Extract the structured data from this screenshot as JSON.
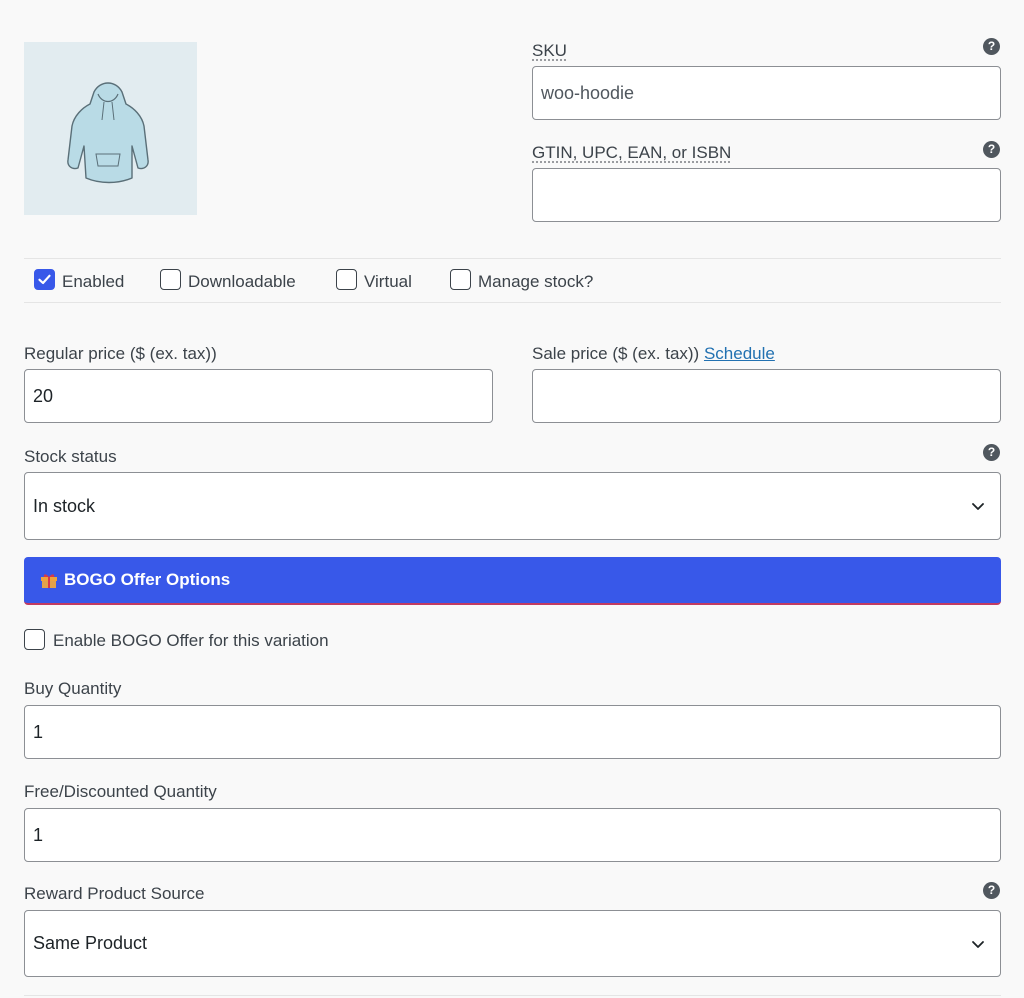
{
  "sku": {
    "label": "SKU",
    "value": "woo-hoodie"
  },
  "gtin": {
    "label": "GTIN, UPC, EAN, or ISBN",
    "value": ""
  },
  "options": [
    {
      "label": "Enabled",
      "checked": true
    },
    {
      "label": "Downloadable",
      "checked": false
    },
    {
      "label": "Virtual",
      "checked": false
    },
    {
      "label": "Manage stock?",
      "checked": false
    }
  ],
  "regular_price": {
    "label": "Regular price ($ (ex. tax))",
    "value": "20"
  },
  "sale_price": {
    "label": "Sale price ($ (ex. tax))",
    "schedule_link": "Schedule",
    "value": ""
  },
  "stock_status": {
    "label": "Stock status",
    "value": "In stock"
  },
  "bogo": {
    "title": "BOGO Offer Options",
    "enable_label": "Enable BOGO Offer for this variation",
    "enabled": false,
    "buy_quantity": {
      "label": "Buy Quantity",
      "value": "1"
    },
    "free_quantity": {
      "label": "Free/Discounted Quantity",
      "value": "1"
    },
    "reward_source": {
      "label": "Reward Product Source",
      "value": "Same Product"
    }
  },
  "help_icon_glyph": "?",
  "colors": {
    "accent": "#3858e9",
    "bar_border": "#c23b62",
    "link": "#2271b1"
  }
}
